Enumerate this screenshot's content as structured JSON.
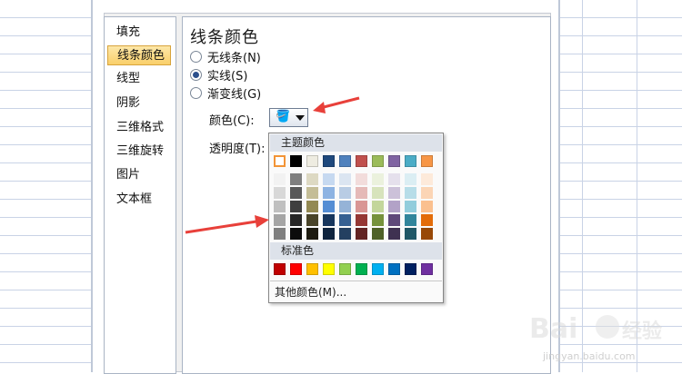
{
  "categories": [
    {
      "label": "填充"
    },
    {
      "label": "线条颜色",
      "selected": true
    },
    {
      "label": "线型"
    },
    {
      "label": "阴影"
    },
    {
      "label": "三维格式"
    },
    {
      "label": "三维旋转"
    },
    {
      "label": "图片"
    },
    {
      "label": "文本框"
    }
  ],
  "panel": {
    "title": "线条颜色",
    "options": [
      {
        "label": "无线条(N)",
        "checked": false
      },
      {
        "label": "实线(S)",
        "checked": true
      },
      {
        "label": "渐变线(G)",
        "checked": false
      }
    ],
    "color_label": "颜色(C):",
    "transparency_label": "透明度(T):"
  },
  "dropdown": {
    "theme_header": "主题颜色",
    "standard_header": "标准色",
    "more_colors": "其他颜色(M)...",
    "theme_colors": [
      "#ffffff",
      "#000000",
      "#eeece1",
      "#1f497d",
      "#4f81bd",
      "#c0504d",
      "#9bbb59",
      "#8064a2",
      "#4bacc6",
      "#f79646"
    ],
    "theme_shades": [
      [
        "#f2f2f2",
        "#d8d8d8",
        "#bfbfbf",
        "#a5a5a5",
        "#7f7f7f"
      ],
      [
        "#7f7f7f",
        "#595959",
        "#3f3f3f",
        "#262626",
        "#0c0c0c"
      ],
      [
        "#ddd9c3",
        "#c4bd97",
        "#938953",
        "#494429",
        "#1d1b10"
      ],
      [
        "#c6d9f0",
        "#8db3e2",
        "#548dd4",
        "#17365d",
        "#0f243e"
      ],
      [
        "#dbe5f1",
        "#b8cce4",
        "#95b3d7",
        "#366092",
        "#244061"
      ],
      [
        "#f2dcdb",
        "#e5b9b7",
        "#d99694",
        "#953734",
        "#632423"
      ],
      [
        "#ebf1dd",
        "#d7e3bc",
        "#c3d69b",
        "#76923c",
        "#4f6128"
      ],
      [
        "#e5e0ec",
        "#ccc1d9",
        "#b2a2c7",
        "#5f497a",
        "#3f3151"
      ],
      [
        "#dbeef3",
        "#b7dde8",
        "#92cddc",
        "#31859b",
        "#205867"
      ],
      [
        "#fdeada",
        "#fbd5b5",
        "#fac08f",
        "#e36c09",
        "#974806"
      ]
    ],
    "standard_colors": [
      "#c00000",
      "#ff0000",
      "#ffc000",
      "#ffff00",
      "#92d050",
      "#00b050",
      "#00b0f0",
      "#0070c0",
      "#002060",
      "#7030a0"
    ]
  },
  "watermark": {
    "text": "jingyan.baidu.com"
  }
}
